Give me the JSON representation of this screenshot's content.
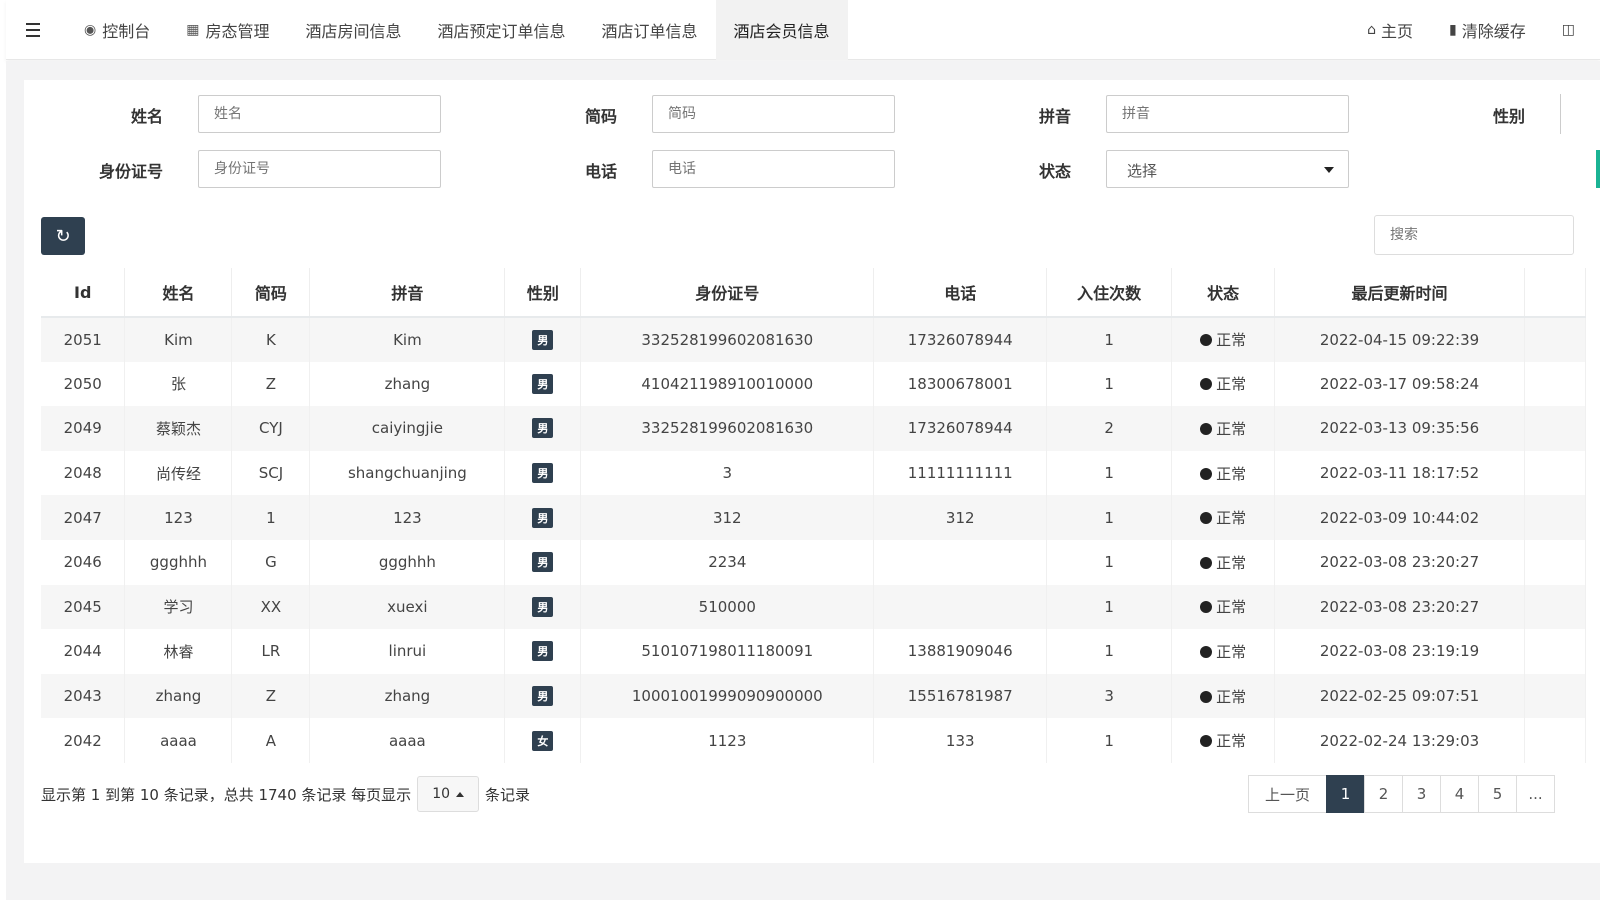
{
  "topnav": {
    "tabs": [
      {
        "label": "控制台",
        "icon": "dashboard-icon"
      },
      {
        "label": "房态管理",
        "icon": "calendar-icon"
      },
      {
        "label": "酒店房间信息"
      },
      {
        "label": "酒店预定订单信息"
      },
      {
        "label": "酒店订单信息"
      },
      {
        "label": "酒店会员信息"
      }
    ],
    "home_label": "主页",
    "clear_cache_label": "清除缓存"
  },
  "filters": {
    "name_label": "姓名",
    "name_placeholder": "姓名",
    "code_label": "简码",
    "code_placeholder": "简码",
    "pinyin_label": "拼音",
    "pinyin_placeholder": "拼音",
    "gender_label": "性别",
    "idcard_label": "身份证号",
    "idcard_placeholder": "身份证号",
    "phone_label": "电话",
    "phone_placeholder": "电话",
    "status_label": "状态",
    "status_value": "选择"
  },
  "toolbar": {
    "search_placeholder": "搜索"
  },
  "table": {
    "columns": [
      "Id",
      "姓名",
      "简码",
      "拼音",
      "性别",
      "身份证号",
      "电话",
      "入住次数",
      "状态",
      "最后更新时间"
    ],
    "rows": [
      [
        "2051",
        "Kim",
        "K",
        "Kim",
        "男",
        "332528199602081630",
        "17326078944",
        "1",
        "正常",
        "2022-04-15 09:22:39"
      ],
      [
        "2050",
        "张",
        "Z",
        "zhang",
        "男",
        "410421198910010000",
        "18300678001",
        "1",
        "正常",
        "2022-03-17 09:58:24"
      ],
      [
        "2049",
        "蔡颖杰",
        "CYJ",
        "caiyingjie",
        "男",
        "332528199602081630",
        "17326078944",
        "2",
        "正常",
        "2022-03-13 09:35:56"
      ],
      [
        "2048",
        "尚传经",
        "SCJ",
        "shangchuanjing",
        "男",
        "3",
        "11111111111",
        "1",
        "正常",
        "2022-03-11 18:17:52"
      ],
      [
        "2047",
        "123",
        "1",
        "123",
        "男",
        "312",
        "312",
        "1",
        "正常",
        "2022-03-09 10:44:02"
      ],
      [
        "2046",
        "ggghhh",
        "G",
        "ggghhh",
        "男",
        "2234",
        "",
        "1",
        "正常",
        "2022-03-08 23:20:27"
      ],
      [
        "2045",
        "学习",
        "XX",
        "xuexi",
        "男",
        "510000",
        "",
        "1",
        "正常",
        "2022-03-08 23:20:27"
      ],
      [
        "2044",
        "林睿",
        "LR",
        "linrui",
        "男",
        "510107198011180091",
        "13881909046",
        "1",
        "正常",
        "2022-03-08 23:19:19"
      ],
      [
        "2043",
        "zhang",
        "Z",
        "zhang",
        "男",
        "10001001999090900000",
        "15516781987",
        "3",
        "正常",
        "2022-02-25 09:07:51"
      ],
      [
        "2042",
        "aaaa",
        "A",
        "aaaa",
        "女",
        "1123",
        "133",
        "1",
        "正常",
        "2022-02-24 13:29:03"
      ]
    ]
  },
  "pager": {
    "info_prefix": "显示第 1 到第 10 条记录，总共 1740 条记录 每页显示",
    "page_size": "10",
    "info_suffix": "条记录",
    "prev_label": "上一页",
    "pages": [
      "1",
      "2",
      "3",
      "4",
      "5",
      "..."
    ],
    "current_page": "1"
  },
  "colors": {
    "accent": "#2f4050",
    "green": "#1ab394"
  }
}
